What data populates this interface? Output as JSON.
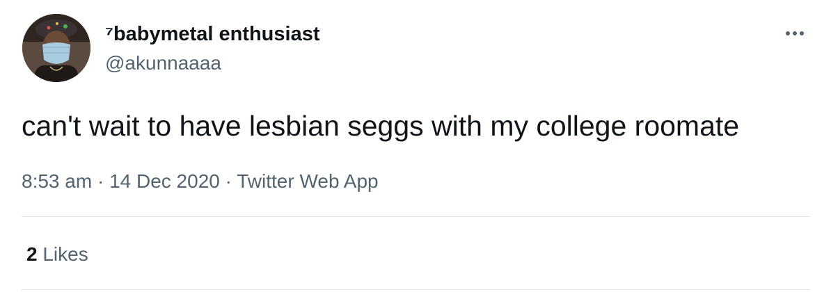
{
  "author": {
    "display_name": "⁷babymetal enthusiast",
    "handle": "@akunnaaaa",
    "avatar_icon": "user-avatar-photo"
  },
  "more_icon": "more-options-icon",
  "tweet": {
    "text": "can't wait to have lesbian seggs with my college roomate",
    "time": "8:53 am",
    "date": "14 Dec 2020",
    "source": "Twitter Web App",
    "separator": "·"
  },
  "stats": {
    "likes_count": "2",
    "likes_label": "Likes"
  },
  "colors": {
    "text_primary": "#0f1419",
    "text_secondary": "#536471",
    "divider": "#e1e8ed"
  }
}
